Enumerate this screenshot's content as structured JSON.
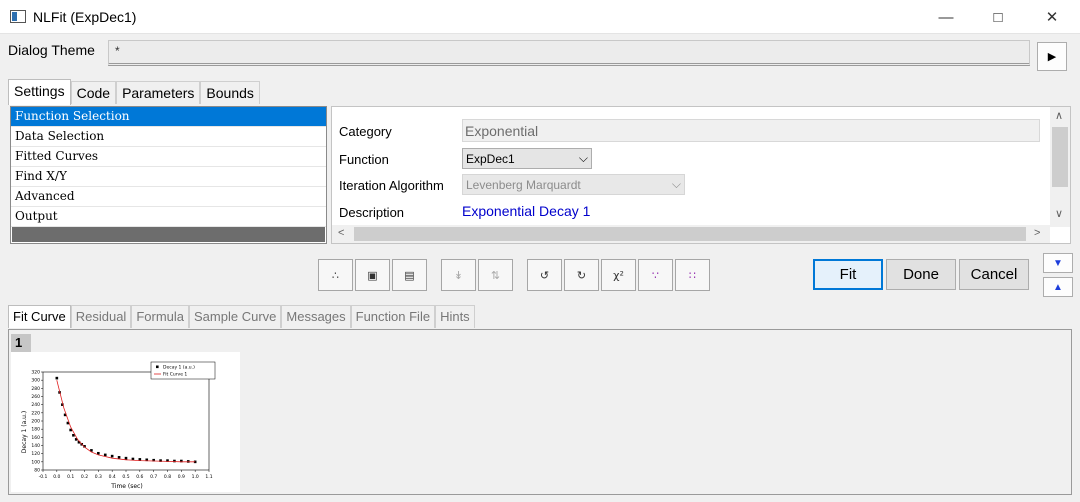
{
  "window": {
    "title": "NLFit (ExpDec1)"
  },
  "theme": {
    "label": "Dialog Theme",
    "value": "*"
  },
  "top_tabs": [
    "Settings",
    "Code",
    "Parameters",
    "Bounds"
  ],
  "nav_items": [
    "Function Selection",
    "Data Selection",
    "Fitted Curves",
    "Find X/Y",
    "Advanced",
    "Output"
  ],
  "settings": {
    "category_label": "Category",
    "category_value": "Exponential",
    "function_label": "Function",
    "function_value": "ExpDec1",
    "iteration_label": "Iteration Algorithm",
    "iteration_value": "Levenberg Marquardt",
    "description_label": "Description",
    "description_value": "Exponential Decay 1"
  },
  "toolbar": {
    "icons": [
      "fit-init-icon",
      "parameter-table-icon",
      "save-icon",
      "fit-until-converged-icon",
      "reset-icon",
      "undo-icon",
      "redo-icon",
      "chi-square-icon",
      "one-iteration-icon",
      "fit-until-done-icon"
    ]
  },
  "actions": {
    "fit": "Fit",
    "done": "Done",
    "cancel": "Cancel"
  },
  "bottom_tabs": [
    "Fit Curve",
    "Residual",
    "Formula",
    "Sample Curve",
    "Messages",
    "Function File",
    "Hints"
  ],
  "graph": {
    "number": "1"
  },
  "chart_data": {
    "type": "scatter",
    "xlabel": "Time (sec)",
    "ylabel": "Decay 1 (a.u.)",
    "xlim": [
      -0.1,
      1.1
    ],
    "ylim": [
      80,
      320
    ],
    "xticks": [
      "-0.1",
      "0.0",
      "0.1",
      "0.2",
      "0.3",
      "0.4",
      "0.5",
      "0.6",
      "0.7",
      "0.8",
      "0.9",
      "1.0",
      "1.1"
    ],
    "yticks": [
      "80",
      "100",
      "120",
      "140",
      "160",
      "180",
      "200",
      "220",
      "240",
      "260",
      "280",
      "300",
      "320"
    ],
    "legend_position": "top-right",
    "series": [
      {
        "name": "Decay 1 (a.u.)",
        "kind": "scatter",
        "color": "#000000",
        "x": [
          0.0,
          0.02,
          0.04,
          0.06,
          0.08,
          0.1,
          0.12,
          0.14,
          0.16,
          0.18,
          0.2,
          0.25,
          0.3,
          0.35,
          0.4,
          0.45,
          0.5,
          0.55,
          0.6,
          0.65,
          0.7,
          0.75,
          0.8,
          0.85,
          0.9,
          0.95,
          1.0
        ],
        "y": [
          305,
          270,
          240,
          215,
          195,
          178,
          165,
          155,
          148,
          143,
          138,
          128,
          121,
          117,
          114,
          111,
          109,
          107,
          106,
          105,
          104,
          103,
          103,
          102,
          102,
          101,
          100
        ]
      },
      {
        "name": "Fit Curve 1",
        "kind": "line",
        "color": "#e02020",
        "x": [
          0.0,
          0.05,
          0.1,
          0.15,
          0.2,
          0.25,
          0.3,
          0.4,
          0.5,
          0.6,
          0.7,
          0.8,
          0.9,
          1.0
        ],
        "y": [
          300,
          232,
          185,
          155,
          136,
          124,
          117,
          109,
          105,
          103,
          102,
          101,
          100,
          100
        ]
      }
    ]
  }
}
